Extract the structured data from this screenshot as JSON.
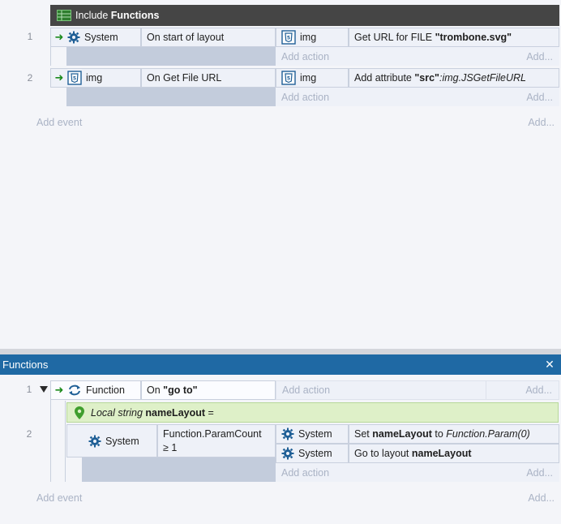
{
  "top_sheet": {
    "include": {
      "prefix": "Include ",
      "name": "Functions"
    },
    "events": [
      {
        "number": "1",
        "object": "System",
        "condition": "On start of layout",
        "action_object": "img",
        "action_prefix": "Get URL for FILE ",
        "action_bold": "\"trombone.svg\"",
        "add_action": "Add action",
        "add_more": "Add..."
      },
      {
        "number": "2",
        "object": "img",
        "condition": "On Get File URL",
        "action_object": "img",
        "action_prefix": "Add attribute ",
        "action_bold": "\"src\"",
        "action_italic": ":img.JSGetFileURL",
        "add_action": "Add action",
        "add_more": "Add..."
      }
    ],
    "add_event": "Add event",
    "add_more": "Add..."
  },
  "functions_panel": {
    "title": "Functions",
    "close_glyph": "✕",
    "event1": {
      "number": "1",
      "object": "Function",
      "condition_prefix": "On ",
      "condition_bold": "\"go to\"",
      "add_action": "Add action",
      "add_more": "Add..."
    },
    "local_var": {
      "italic": "Local string ",
      "bold": "nameLayout",
      "suffix": " ="
    },
    "event2": {
      "number": "2",
      "object": "System",
      "condition_line1": "Function.ParamCount",
      "condition_line2": "≥ 1",
      "actions": [
        {
          "object": "System",
          "prefix": "Set ",
          "bold": "nameLayout",
          "mid": " to ",
          "italic": "Function.Param(0)"
        },
        {
          "object": "System",
          "prefix": "Go to layout ",
          "bold": "nameLayout"
        }
      ],
      "add_action": "Add action",
      "add_more": "Add..."
    },
    "add_event": "Add event",
    "add_more": "Add..."
  },
  "colors": {
    "include_header": "#454545",
    "panel_header": "#1f69a4",
    "local_var_bg": "#def0c8",
    "arrow": "#1b8a1b",
    "gear": "#1f5f96"
  }
}
